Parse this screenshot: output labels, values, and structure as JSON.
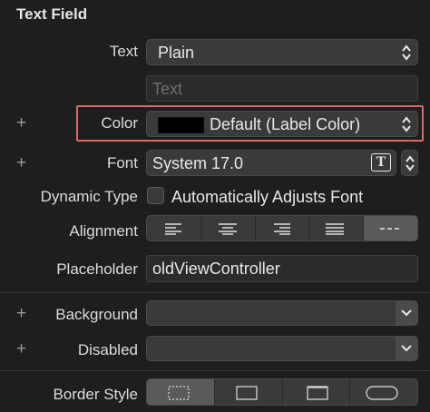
{
  "section": {
    "title": "Text Field"
  },
  "text_row": {
    "label": "Text",
    "value": "Plain",
    "placeholder": "Text"
  },
  "color_row": {
    "label": "Color",
    "value": "Default (Label Color)",
    "swatch_color": "#000000"
  },
  "font_row": {
    "label": "Font",
    "value": "System 17.0",
    "font_picker_glyph": "T"
  },
  "dynamic_type_row": {
    "label": "Dynamic Type",
    "checkbox_label": "Automatically Adjusts Font",
    "checked": false
  },
  "alignment_row": {
    "label": "Alignment",
    "options": [
      "left-align-icon",
      "center-align-icon",
      "right-align-icon",
      "justify-align-icon",
      "natural-align-icon"
    ],
    "selected": "natural-align-icon"
  },
  "placeholder_row": {
    "label": "Placeholder",
    "value": "oldViewController"
  },
  "background_row": {
    "label": "Background",
    "value": ""
  },
  "disabled_row": {
    "label": "Disabled",
    "value": ""
  },
  "border_style_row": {
    "label": "Border Style",
    "options": [
      "no-border-icon",
      "line-border-icon",
      "bezel-border-icon",
      "rounded-border-icon"
    ],
    "selected": "no-border-icon"
  },
  "plus_glyph": "+",
  "colors": {
    "highlight": "#e06767",
    "panel": "#1e1e1e",
    "control": "#3a3a3c"
  }
}
